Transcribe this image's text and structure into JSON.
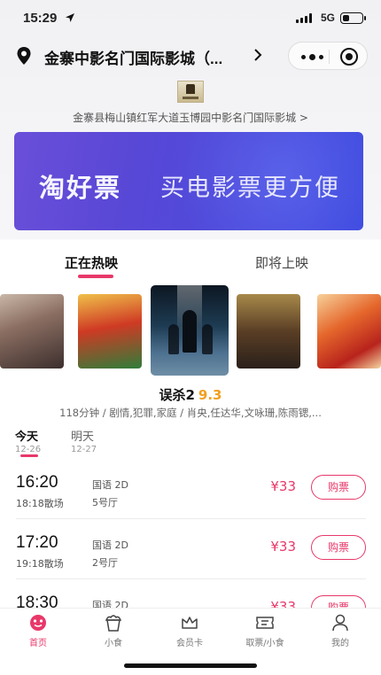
{
  "status_bar": {
    "time": "15:29",
    "network": "5G",
    "battery_level": 0.35
  },
  "header": {
    "cinema_name": "金寨中影名门国际影城（..."
  },
  "address": "金寨县梅山镇红军大道玉博园中影名门国际影城 >",
  "banner": {
    "bold": "淘好票",
    "light": "买电影票更方便"
  },
  "tabs": {
    "now_showing": "正在热映",
    "coming_soon": "即将上映"
  },
  "posters": [
    {
      "title": ""
    },
    {
      "title": ""
    },
    {
      "title": ""
    },
    {
      "title": ""
    },
    {
      "title": ""
    }
  ],
  "movie": {
    "title": "误杀2",
    "score": "9.3",
    "meta": "118分钟 / 剧情,犯罪,家庭 / 肖央,任达华,文咏珊,陈雨锶,..."
  },
  "dates": [
    {
      "label": "今天",
      "date": "12-26"
    },
    {
      "label": "明天",
      "date": "12-27"
    }
  ],
  "sessions": [
    {
      "time": "16:20",
      "end": "18:18散场",
      "lang": "国语 2D",
      "hall": "5号厅",
      "price": "¥33",
      "button": "购票"
    },
    {
      "time": "17:20",
      "end": "19:18散场",
      "lang": "国语 2D",
      "hall": "2号厅",
      "price": "¥33",
      "button": "购票"
    },
    {
      "time": "18:30",
      "end": "",
      "lang": "国语 2D",
      "hall": "",
      "price": "¥33",
      "button": "购票"
    }
  ],
  "tabbar": [
    {
      "label": "首页",
      "icon": "home-icon"
    },
    {
      "label": "小食",
      "icon": "snack-icon"
    },
    {
      "label": "会员卡",
      "icon": "crown-icon"
    },
    {
      "label": "取票/小食",
      "icon": "ticket-icon"
    },
    {
      "label": "我的",
      "icon": "person-icon"
    }
  ],
  "colors": {
    "accent": "#e8386a",
    "score": "#f0a020",
    "banner": "#4f4bdc"
  }
}
